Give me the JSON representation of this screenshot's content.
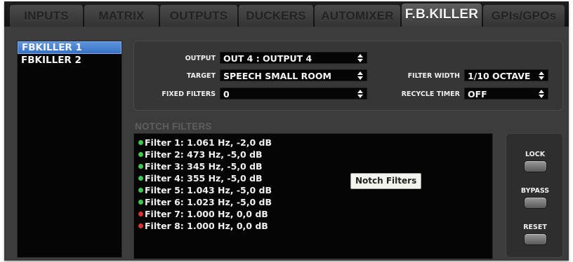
{
  "tabs": [
    {
      "label": "INPUTS"
    },
    {
      "label": "MATRIX"
    },
    {
      "label": "OUTPUTS"
    },
    {
      "label": "DUCKERS"
    },
    {
      "label": "AUTOMIXER"
    },
    {
      "label": "F.B.KILLER",
      "active": true
    },
    {
      "label": "GPIs/GPOs"
    }
  ],
  "instances": [
    {
      "label": "FBKILLER 1",
      "selected": true
    },
    {
      "label": "FBKILLER 2",
      "selected": false
    }
  ],
  "settings": {
    "output_label": "OUTPUT",
    "output_value": "OUT 4 : OUTPUT 4",
    "target_label": "TARGET",
    "target_value": "SPEECH SMALL ROOM",
    "fixed_filters_label": "FIXED FILTERS",
    "fixed_filters_value": "0",
    "filter_width_label": "FILTER WIDTH",
    "filter_width_value": "1/10 OCTAVE",
    "recycle_timer_label": "RECYCLE TIMER",
    "recycle_timer_value": "OFF"
  },
  "notch": {
    "title": "NOTCH FILTERS",
    "tooltip": "Notch Filters",
    "filters": [
      {
        "text": "Filter 1: 1.061 Hz, -2,0 dB",
        "status": "green"
      },
      {
        "text": "Filter 2: 473 Hz, -5,0 dB",
        "status": "green"
      },
      {
        "text": "Filter 3: 345 Hz, -5,0 dB",
        "status": "green"
      },
      {
        "text": "Filter 4: 355 Hz, -5,0 dB",
        "status": "green"
      },
      {
        "text": "Filter 5: 1.043 Hz, -5,0 dB",
        "status": "green"
      },
      {
        "text": "Filter 6: 1.023 Hz, -5,0 dB",
        "status": "green"
      },
      {
        "text": "Filter 7: 1.000 Hz, 0,0 dB",
        "status": "red"
      },
      {
        "text": "Filter 8: 1.000 Hz, 0,0 dB",
        "status": "red"
      }
    ]
  },
  "actions": {
    "lock_label": "LOCK",
    "bypass_label": "BYPASS",
    "reset_label": "RESET"
  },
  "colors": {
    "active_filter": "#3ec94a",
    "inactive_filter": "#e0322b",
    "selection": "#4a84d4"
  }
}
